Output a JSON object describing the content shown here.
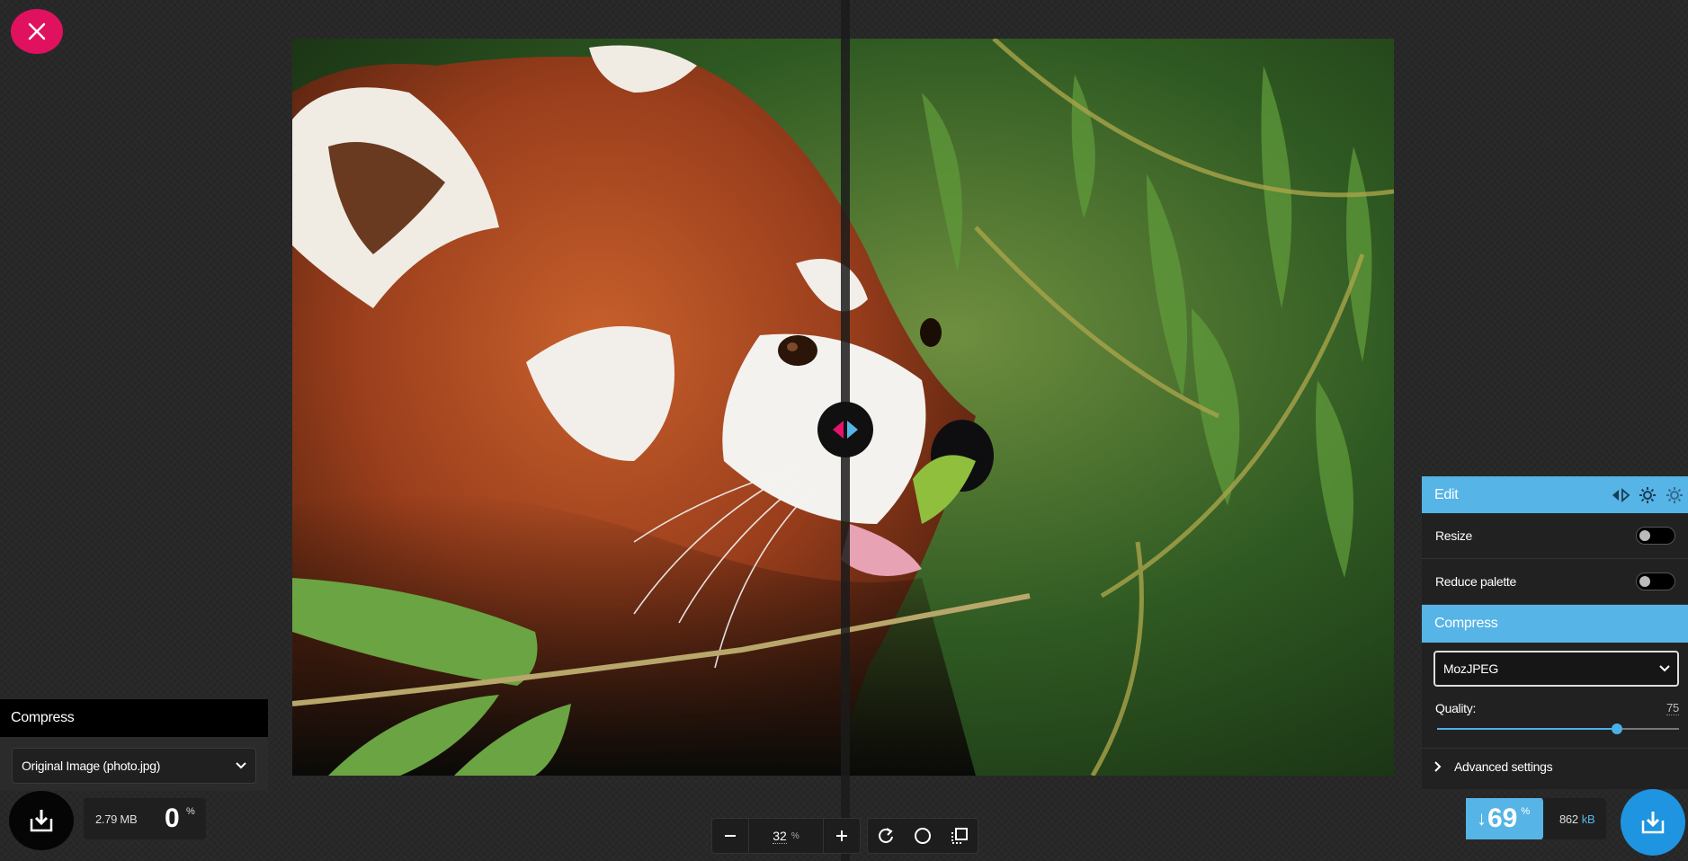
{
  "left_panel": {
    "header": "Compress",
    "select_value": "Original Image (photo.jpg)"
  },
  "left_results": {
    "size": "2.79 MB",
    "percent": "0",
    "percent_symbol": "%"
  },
  "zoom": {
    "value": "32",
    "unit": "%"
  },
  "right_panel": {
    "edit_header": "Edit",
    "resize_label": "Resize",
    "resize_enabled": false,
    "reduce_palette_label": "Reduce palette",
    "reduce_palette_enabled": false,
    "compress_header": "Compress",
    "codec": "MozJPEG",
    "quality_label": "Quality:",
    "quality_value": "75",
    "advanced_label": "Advanced settings"
  },
  "right_results": {
    "arrow": "↓",
    "percent": "69",
    "percent_symbol": "%",
    "size": "862",
    "size_unit": "kB"
  },
  "colors": {
    "close_button": "#e0115f",
    "accent_blue": "#56b4e6",
    "download_blue": "#1f94e0"
  },
  "icons": {
    "close": "close-icon",
    "divider_handle": "split-arrows-icon",
    "download": "download-icon",
    "zoom_out": "minus-icon",
    "zoom_in": "plus-icon",
    "rotate": "rotate-icon",
    "background": "circle-icon",
    "crop": "crop-icon",
    "chevron": "chevron-down-icon",
    "expand": "chevron-right-icon"
  }
}
